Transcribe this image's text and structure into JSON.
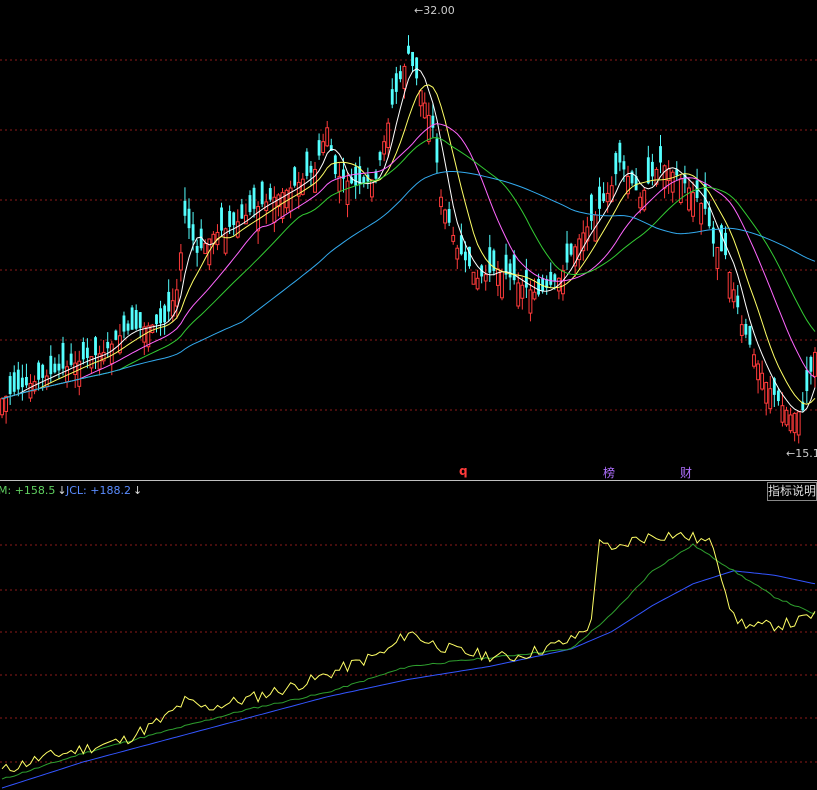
{
  "labels": {
    "high_marker": "32.00",
    "low_marker": "15.1",
    "event_q": "q",
    "event_bang": "榜",
    "event_cai": "财",
    "ind_m_text": "M: +158.5",
    "ind_jcl_text": "JCL: +188.2",
    "arrow_down": "↓",
    "explain_button": "指标说明"
  },
  "colors": {
    "up": "#ff3b3b",
    "down": "#54ffff",
    "ma5": "#ffffff",
    "ma10": "#ffff66",
    "ma20": "#ff66ff",
    "ma30": "#33cc33",
    "ma60": "#33aaee",
    "ind_yellow": "#ffff66",
    "ind_green": "#2e9e2e",
    "ind_blue": "#3355ff",
    "grid": "#8b1a1a"
  },
  "chart_data": [
    {
      "type": "candlestick",
      "ylim": [
        14,
        33
      ],
      "high_label": 32.0,
      "low_label": 15.1,
      "anchors": [
        [
          0,
          16.3
        ],
        [
          5,
          16.8
        ],
        [
          10,
          17.2
        ],
        [
          15,
          17.6
        ],
        [
          20,
          18.0
        ],
        [
          25,
          18.3
        ],
        [
          30,
          19.2
        ],
        [
          35,
          19.4
        ],
        [
          40,
          19.6
        ],
        [
          43,
          21.0
        ],
        [
          45,
          24.2
        ],
        [
          48,
          22.6
        ],
        [
          52,
          23.4
        ],
        [
          57,
          23.8
        ],
        [
          62,
          24.5
        ],
        [
          67,
          25.0
        ],
        [
          72,
          25.5
        ],
        [
          77,
          26.2
        ],
        [
          80,
          28.0
        ],
        [
          82,
          26.0
        ],
        [
          87,
          25.5
        ],
        [
          92,
          25.8
        ],
        [
          96,
          29.0
        ],
        [
          100,
          31.2
        ],
        [
          103,
          29.6
        ],
        [
          106,
          28.0
        ],
        [
          108,
          25.0
        ],
        [
          112,
          22.8
        ],
        [
          117,
          21.5
        ],
        [
          122,
          21.9
        ],
        [
          127,
          21.3
        ],
        [
          132,
          20.8
        ],
        [
          137,
          21.5
        ],
        [
          142,
          23.2
        ],
        [
          147,
          24.5
        ],
        [
          150,
          25.5
        ],
        [
          152,
          26.5
        ],
        [
          157,
          25.0
        ],
        [
          162,
          26.5
        ],
        [
          167,
          25.8
        ],
        [
          170,
          25.2
        ],
        [
          173,
          24.5
        ],
        [
          175,
          23.0
        ],
        [
          178,
          22.5
        ],
        [
          182,
          19.5
        ],
        [
          185,
          18.2
        ],
        [
          188,
          17.0
        ],
        [
          191,
          16.2
        ],
        [
          194,
          15.6
        ],
        [
          197,
          15.8
        ],
        [
          200,
          18.3
        ]
      ],
      "count": 201
    },
    {
      "type": "line",
      "series": [
        {
          "key": "yellow"
        },
        {
          "key": "green"
        },
        {
          "key": "blue"
        }
      ],
      "ylim": [
        0,
        320
      ],
      "yellow_anchors": [
        [
          0,
          20
        ],
        [
          10,
          35
        ],
        [
          20,
          45
        ],
        [
          30,
          55
        ],
        [
          40,
          80
        ],
        [
          45,
          100
        ],
        [
          50,
          92
        ],
        [
          60,
          102
        ],
        [
          70,
          115
        ],
        [
          77,
          125
        ],
        [
          85,
          140
        ],
        [
          95,
          158
        ],
        [
          100,
          180
        ],
        [
          105,
          168
        ],
        [
          110,
          160
        ],
        [
          115,
          155
        ],
        [
          125,
          150
        ],
        [
          130,
          156
        ],
        [
          140,
          170
        ],
        [
          145,
          190
        ],
        [
          147,
          290
        ],
        [
          150,
          270
        ],
        [
          155,
          285
        ],
        [
          160,
          290
        ],
        [
          165,
          292
        ],
        [
          170,
          288
        ],
        [
          175,
          280
        ],
        [
          180,
          195
        ],
        [
          185,
          185
        ],
        [
          195,
          190
        ],
        [
          200,
          200
        ]
      ],
      "green_anchors": [
        [
          0,
          10
        ],
        [
          20,
          40
        ],
        [
          40,
          65
        ],
        [
          60,
          90
        ],
        [
          80,
          110
        ],
        [
          100,
          140
        ],
        [
          120,
          150
        ],
        [
          140,
          160
        ],
        [
          150,
          200
        ],
        [
          160,
          250
        ],
        [
          170,
          280
        ],
        [
          180,
          250
        ],
        [
          190,
          220
        ],
        [
          200,
          200
        ]
      ],
      "blue_anchors": [
        [
          0,
          0
        ],
        [
          20,
          30
        ],
        [
          40,
          55
        ],
        [
          60,
          80
        ],
        [
          80,
          105
        ],
        [
          100,
          125
        ],
        [
          120,
          140
        ],
        [
          140,
          160
        ],
        [
          150,
          180
        ],
        [
          160,
          210
        ],
        [
          170,
          235
        ],
        [
          180,
          250
        ],
        [
          190,
          245
        ],
        [
          200,
          235
        ]
      ]
    }
  ]
}
